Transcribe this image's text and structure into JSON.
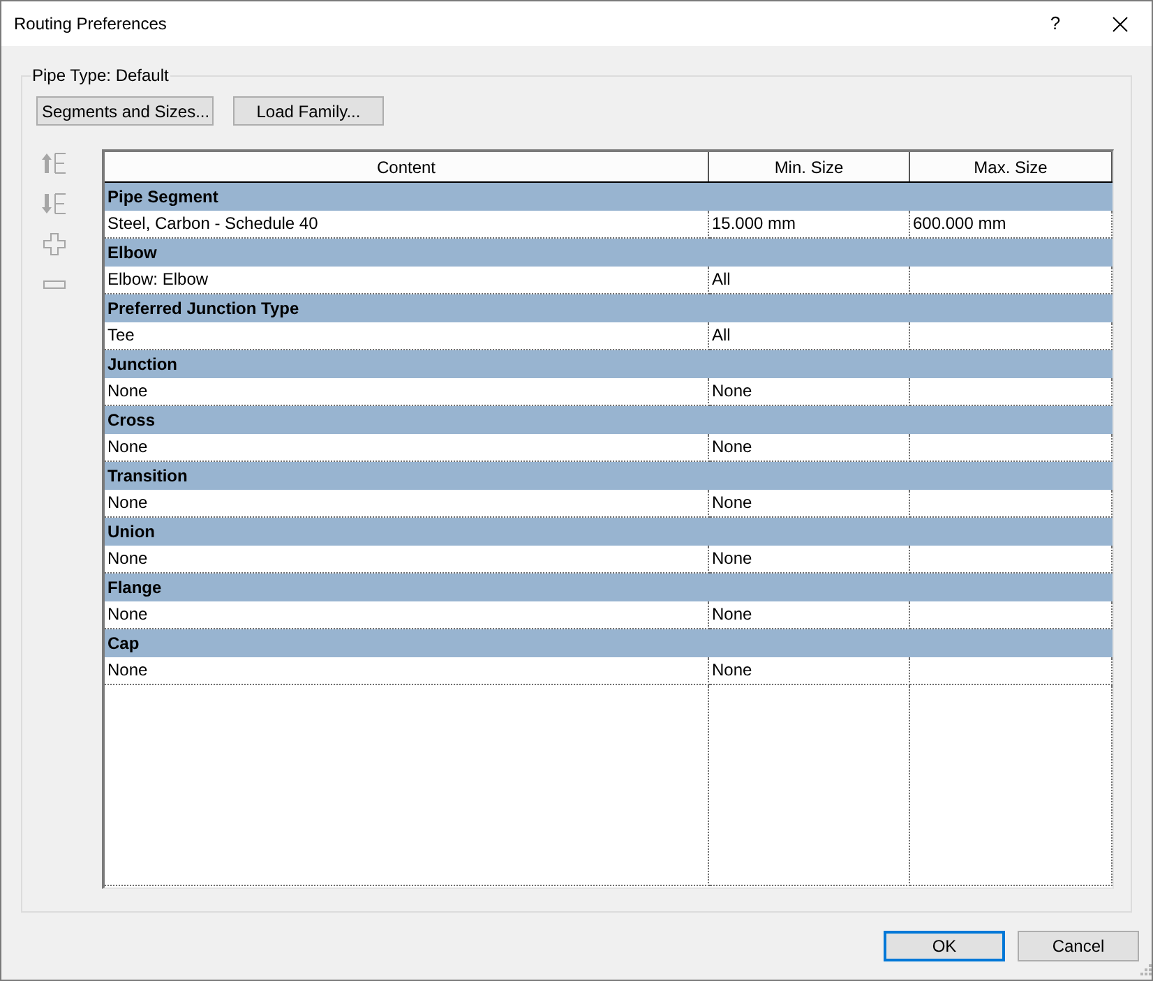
{
  "window": {
    "title": "Routing Preferences",
    "help_button": "?"
  },
  "group": {
    "legend": "Pipe Type: Default"
  },
  "toolbar_buttons": [
    {
      "label": "Segments and Sizes..."
    },
    {
      "label": "Load Family..."
    }
  ],
  "side_tools": [
    {
      "kind": "move-up",
      "disabled": true
    },
    {
      "kind": "move-down",
      "disabled": true
    },
    {
      "kind": "add",
      "disabled": true
    },
    {
      "kind": "remove",
      "disabled": true
    }
  ],
  "table": {
    "columns": [
      "Content",
      "Min. Size",
      "Max. Size"
    ],
    "sections": [
      {
        "title": "Pipe Segment",
        "rows": [
          {
            "content": "Steel, Carbon - Schedule 40",
            "min_size": "15.000 mm",
            "max_size": "600.000 mm"
          }
        ]
      },
      {
        "title": "Elbow",
        "rows": [
          {
            "content": "Elbow: Elbow",
            "min_size": "All"
          }
        ]
      },
      {
        "title": "Preferred Junction Type",
        "rows": [
          {
            "content": "Tee",
            "min_size": "All"
          }
        ]
      },
      {
        "title": "Junction",
        "rows": [
          {
            "content": "None",
            "min_size": "None"
          }
        ]
      },
      {
        "title": "Cross",
        "rows": [
          {
            "content": "None",
            "min_size": "None"
          }
        ]
      },
      {
        "title": "Transition",
        "rows": [
          {
            "content": "None",
            "min_size": "None"
          }
        ]
      },
      {
        "title": "Union",
        "rows": [
          {
            "content": "None",
            "min_size": "None"
          }
        ]
      },
      {
        "title": "Flange",
        "rows": [
          {
            "content": "None",
            "min_size": "None"
          }
        ]
      },
      {
        "title": "Cap",
        "rows": [
          {
            "content": "None",
            "min_size": "None"
          }
        ]
      }
    ]
  },
  "buttons": [
    {
      "label": "OK",
      "default": true
    },
    {
      "label": "Cancel",
      "default": false
    }
  ]
}
